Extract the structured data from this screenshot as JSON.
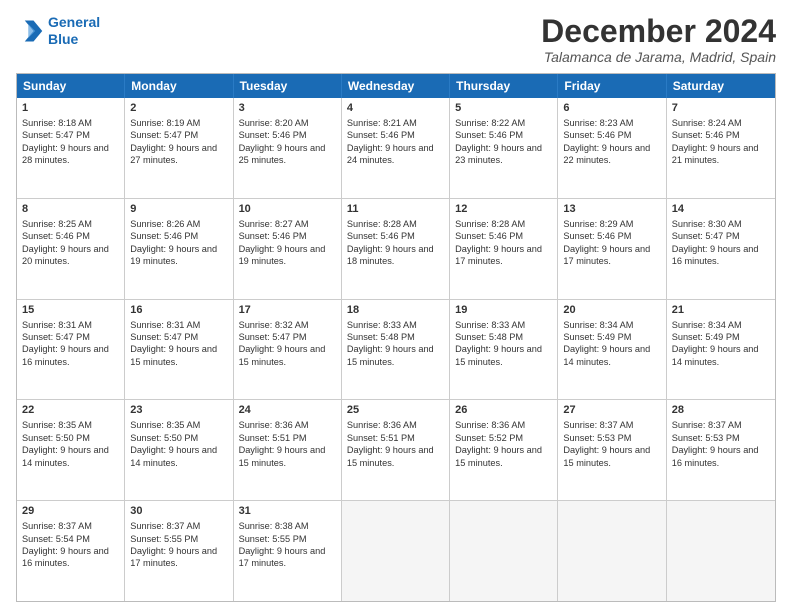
{
  "logo": {
    "line1": "General",
    "line2": "Blue"
  },
  "title": "December 2024",
  "subtitle": "Talamanca de Jarama, Madrid, Spain",
  "header_days": [
    "Sunday",
    "Monday",
    "Tuesday",
    "Wednesday",
    "Thursday",
    "Friday",
    "Saturday"
  ],
  "weeks": [
    [
      {
        "day": "1",
        "sunrise": "Sunrise: 8:18 AM",
        "sunset": "Sunset: 5:47 PM",
        "daylight": "Daylight: 9 hours and 28 minutes."
      },
      {
        "day": "2",
        "sunrise": "Sunrise: 8:19 AM",
        "sunset": "Sunset: 5:47 PM",
        "daylight": "Daylight: 9 hours and 27 minutes."
      },
      {
        "day": "3",
        "sunrise": "Sunrise: 8:20 AM",
        "sunset": "Sunset: 5:46 PM",
        "daylight": "Daylight: 9 hours and 25 minutes."
      },
      {
        "day": "4",
        "sunrise": "Sunrise: 8:21 AM",
        "sunset": "Sunset: 5:46 PM",
        "daylight": "Daylight: 9 hours and 24 minutes."
      },
      {
        "day": "5",
        "sunrise": "Sunrise: 8:22 AM",
        "sunset": "Sunset: 5:46 PM",
        "daylight": "Daylight: 9 hours and 23 minutes."
      },
      {
        "day": "6",
        "sunrise": "Sunrise: 8:23 AM",
        "sunset": "Sunset: 5:46 PM",
        "daylight": "Daylight: 9 hours and 22 minutes."
      },
      {
        "day": "7",
        "sunrise": "Sunrise: 8:24 AM",
        "sunset": "Sunset: 5:46 PM",
        "daylight": "Daylight: 9 hours and 21 minutes."
      }
    ],
    [
      {
        "day": "8",
        "sunrise": "Sunrise: 8:25 AM",
        "sunset": "Sunset: 5:46 PM",
        "daylight": "Daylight: 9 hours and 20 minutes."
      },
      {
        "day": "9",
        "sunrise": "Sunrise: 8:26 AM",
        "sunset": "Sunset: 5:46 PM",
        "daylight": "Daylight: 9 hours and 19 minutes."
      },
      {
        "day": "10",
        "sunrise": "Sunrise: 8:27 AM",
        "sunset": "Sunset: 5:46 PM",
        "daylight": "Daylight: 9 hours and 19 minutes."
      },
      {
        "day": "11",
        "sunrise": "Sunrise: 8:28 AM",
        "sunset": "Sunset: 5:46 PM",
        "daylight": "Daylight: 9 hours and 18 minutes."
      },
      {
        "day": "12",
        "sunrise": "Sunrise: 8:28 AM",
        "sunset": "Sunset: 5:46 PM",
        "daylight": "Daylight: 9 hours and 17 minutes."
      },
      {
        "day": "13",
        "sunrise": "Sunrise: 8:29 AM",
        "sunset": "Sunset: 5:46 PM",
        "daylight": "Daylight: 9 hours and 17 minutes."
      },
      {
        "day": "14",
        "sunrise": "Sunrise: 8:30 AM",
        "sunset": "Sunset: 5:47 PM",
        "daylight": "Daylight: 9 hours and 16 minutes."
      }
    ],
    [
      {
        "day": "15",
        "sunrise": "Sunrise: 8:31 AM",
        "sunset": "Sunset: 5:47 PM",
        "daylight": "Daylight: 9 hours and 16 minutes."
      },
      {
        "day": "16",
        "sunrise": "Sunrise: 8:31 AM",
        "sunset": "Sunset: 5:47 PM",
        "daylight": "Daylight: 9 hours and 15 minutes."
      },
      {
        "day": "17",
        "sunrise": "Sunrise: 8:32 AM",
        "sunset": "Sunset: 5:47 PM",
        "daylight": "Daylight: 9 hours and 15 minutes."
      },
      {
        "day": "18",
        "sunrise": "Sunrise: 8:33 AM",
        "sunset": "Sunset: 5:48 PM",
        "daylight": "Daylight: 9 hours and 15 minutes."
      },
      {
        "day": "19",
        "sunrise": "Sunrise: 8:33 AM",
        "sunset": "Sunset: 5:48 PM",
        "daylight": "Daylight: 9 hours and 15 minutes."
      },
      {
        "day": "20",
        "sunrise": "Sunrise: 8:34 AM",
        "sunset": "Sunset: 5:49 PM",
        "daylight": "Daylight: 9 hours and 14 minutes."
      },
      {
        "day": "21",
        "sunrise": "Sunrise: 8:34 AM",
        "sunset": "Sunset: 5:49 PM",
        "daylight": "Daylight: 9 hours and 14 minutes."
      }
    ],
    [
      {
        "day": "22",
        "sunrise": "Sunrise: 8:35 AM",
        "sunset": "Sunset: 5:50 PM",
        "daylight": "Daylight: 9 hours and 14 minutes."
      },
      {
        "day": "23",
        "sunrise": "Sunrise: 8:35 AM",
        "sunset": "Sunset: 5:50 PM",
        "daylight": "Daylight: 9 hours and 14 minutes."
      },
      {
        "day": "24",
        "sunrise": "Sunrise: 8:36 AM",
        "sunset": "Sunset: 5:51 PM",
        "daylight": "Daylight: 9 hours and 15 minutes."
      },
      {
        "day": "25",
        "sunrise": "Sunrise: 8:36 AM",
        "sunset": "Sunset: 5:51 PM",
        "daylight": "Daylight: 9 hours and 15 minutes."
      },
      {
        "day": "26",
        "sunrise": "Sunrise: 8:36 AM",
        "sunset": "Sunset: 5:52 PM",
        "daylight": "Daylight: 9 hours and 15 minutes."
      },
      {
        "day": "27",
        "sunrise": "Sunrise: 8:37 AM",
        "sunset": "Sunset: 5:53 PM",
        "daylight": "Daylight: 9 hours and 15 minutes."
      },
      {
        "day": "28",
        "sunrise": "Sunrise: 8:37 AM",
        "sunset": "Sunset: 5:53 PM",
        "daylight": "Daylight: 9 hours and 16 minutes."
      }
    ],
    [
      {
        "day": "29",
        "sunrise": "Sunrise: 8:37 AM",
        "sunset": "Sunset: 5:54 PM",
        "daylight": "Daylight: 9 hours and 16 minutes."
      },
      {
        "day": "30",
        "sunrise": "Sunrise: 8:37 AM",
        "sunset": "Sunset: 5:55 PM",
        "daylight": "Daylight: 9 hours and 17 minutes."
      },
      {
        "day": "31",
        "sunrise": "Sunrise: 8:38 AM",
        "sunset": "Sunset: 5:55 PM",
        "daylight": "Daylight: 9 hours and 17 minutes."
      },
      null,
      null,
      null,
      null
    ]
  ]
}
